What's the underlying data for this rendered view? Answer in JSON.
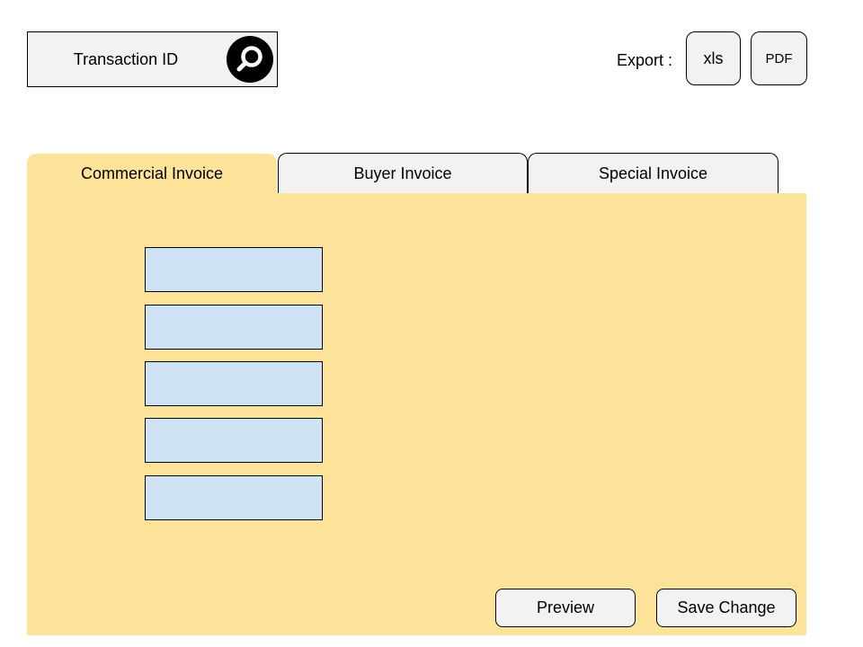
{
  "search": {
    "placeholder": "Transaction ID",
    "value": "",
    "icon": "search-icon"
  },
  "export": {
    "label": "Export :",
    "buttons": [
      {
        "label": "xls"
      },
      {
        "label": "PDF"
      }
    ]
  },
  "tabs": [
    {
      "label": "Commercial Invoice",
      "active": true
    },
    {
      "label": "Buyer Invoice",
      "active": false
    },
    {
      "label": "Special Invoice",
      "active": false
    }
  ],
  "form": {
    "fields": [
      {
        "value": ""
      },
      {
        "value": ""
      },
      {
        "value": ""
      },
      {
        "value": ""
      },
      {
        "value": ""
      }
    ]
  },
  "actions": {
    "preview_label": "Preview",
    "save_label": "Save Change"
  },
  "colors": {
    "panel_background": "#fde39a",
    "field_background": "#cfe2f3",
    "button_background": "#f2f2f2"
  }
}
